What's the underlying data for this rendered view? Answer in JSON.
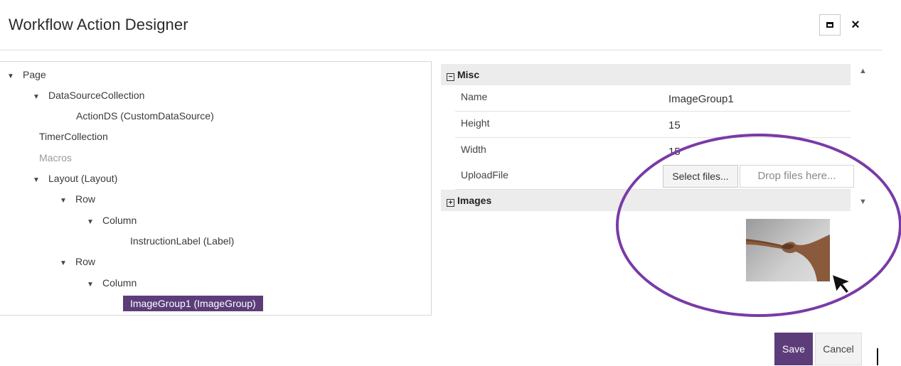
{
  "dialog": {
    "title": "Workflow Action Designer",
    "icons": {
      "maximize": "maximize-icon",
      "close": "close-icon"
    },
    "close_glyph": "×"
  },
  "tree": {
    "expand_glyph": "▼",
    "nodes": [
      {
        "label": "Page",
        "expanded": true
      },
      {
        "label": "DataSourceCollection",
        "expanded": true
      },
      {
        "label": "ActionDS (CustomDataSource)"
      },
      {
        "label": "TimerCollection"
      },
      {
        "label": "Macros",
        "disabled": true
      },
      {
        "label": "Layout (Layout)",
        "expanded": true
      },
      {
        "label": "Row",
        "expanded": true
      },
      {
        "label": "Column",
        "expanded": true
      },
      {
        "label": "InstructionLabel (Label)"
      },
      {
        "label": "Row",
        "expanded": true
      },
      {
        "label": "Column",
        "expanded": true
      },
      {
        "label": "ImageGroup1 (ImageGroup)",
        "selected": true
      }
    ]
  },
  "properties": {
    "groups": [
      {
        "label": "Misc",
        "toggle": "⊟"
      },
      {
        "label": "Images",
        "toggle": "⊞"
      }
    ],
    "collapse_glyph": "−",
    "expand_glyph": "+",
    "rows": [
      {
        "name": "Name",
        "value": "ImageGroup1"
      },
      {
        "name": "Height",
        "value": "15"
      },
      {
        "name": "Width",
        "value": "15"
      },
      {
        "name": "UploadFile",
        "value": ""
      }
    ],
    "upload": {
      "button_label": "Select files...",
      "drop_label": "Drop files here..."
    },
    "scroll_up_glyph": "▲",
    "scroll_down_glyph": "▼"
  },
  "footer": {
    "save_label": "Save",
    "cancel_label": "Cancel"
  },
  "colors": {
    "accent": "#5c3d7a",
    "highlight_circle": "#7a3aa6"
  }
}
